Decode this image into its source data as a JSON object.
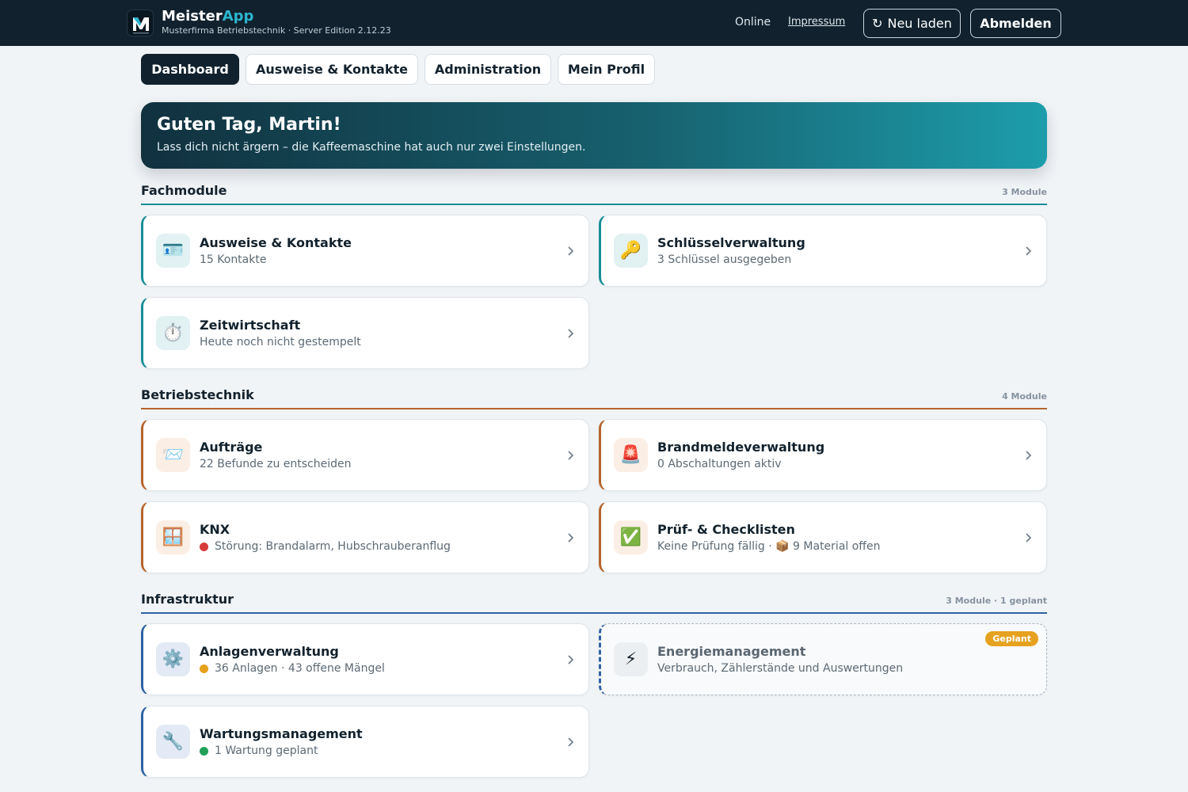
{
  "header": {
    "brand_main": "Meister",
    "brand_accent": "App",
    "subtitle": "Musterfirma Betriebstechnik · Server Edition 2.12.23",
    "status": "Online",
    "impressum": "Impressum",
    "reload_icon": "↻",
    "reload_label": "Neu laden",
    "logout_label": "Abmelden",
    "logo_letter": "M"
  },
  "nav": {
    "tabs": [
      {
        "label": "Dashboard",
        "active": true
      },
      {
        "label": "Ausweise & Kontakte",
        "active": false
      },
      {
        "label": "Administration",
        "active": false
      },
      {
        "label": "Mein Profil",
        "active": false
      }
    ]
  },
  "hero": {
    "title": "Guten Tag, Martin!",
    "subtitle": "Lass dich nicht ärgern – die Kaffeemaschine hat auch nur zwei Einstellungen."
  },
  "sections": [
    {
      "title": "Fachmodule",
      "count": "3 Module",
      "color": "#178f97",
      "cards": [
        {
          "icon": "🪪",
          "icon_name": "id-card-icon",
          "title": "Ausweise & Kontakte",
          "subtitle": "15 Kontakte"
        },
        {
          "icon": "🔑",
          "icon_name": "key-icon",
          "title": "Schlüsselverwaltung",
          "subtitle": "3 Schlüssel ausgegeben"
        },
        {
          "icon": "⏱️",
          "icon_name": "stopwatch-icon",
          "title": "Zeitwirtschaft",
          "subtitle": "Heute noch nicht gestempelt"
        }
      ]
    },
    {
      "title": "Betriebstechnik",
      "count": "4 Module",
      "color": "#b5652c",
      "cards": [
        {
          "icon": "📨",
          "icon_name": "envelope-icon",
          "title": "Aufträge",
          "subtitle": "22 Befunde zu entscheiden"
        },
        {
          "icon": "🚨",
          "icon_name": "siren-icon",
          "title": "Brandmeldeverwaltung",
          "subtitle": "0 Abschaltungen aktiv"
        },
        {
          "icon": "🪟",
          "icon_name": "window-icon",
          "title": "KNX",
          "subtitle": "Störung: Brandalarm, Hubschrauberanflug",
          "dot": "#d63b3b"
        },
        {
          "icon": "✅",
          "icon_name": "check-icon",
          "title": "Prüf- & Checklisten",
          "subtitle": "Keine Prüfung fällig · 📦 9 Material offen"
        }
      ]
    },
    {
      "title": "Infrastruktur",
      "count": "3 Module · 1 geplant",
      "color": "#2f62a3",
      "cards": [
        {
          "icon": "⚙️",
          "icon_name": "gear-icon",
          "title": "Anlagenverwaltung",
          "subtitle": "36 Anlagen · 43 offene Mängel",
          "dot": "#e6a11f"
        },
        {
          "icon": "⚡",
          "icon_name": "lightning-icon",
          "title": "Energiemanagement",
          "subtitle": "Verbrauch, Zählerstände und Auswertungen",
          "badge": "Geplant"
        },
        {
          "icon": "🔧",
          "icon_name": "wrench-icon",
          "title": "Wartungsmanagement",
          "subtitle": "1 Wartung geplant",
          "dot": "#22a05a"
        }
      ]
    }
  ]
}
